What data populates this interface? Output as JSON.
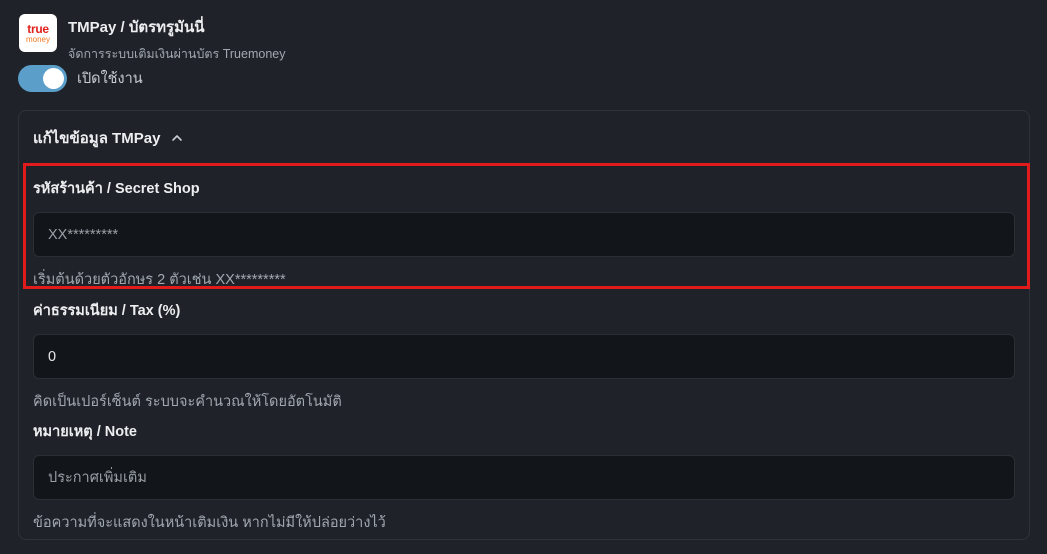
{
  "header": {
    "logo_line1": "true",
    "logo_line2": "money",
    "title": "TMPay / บัตรทรูมันนี่",
    "subtitle": "จัดการระบบเติมเงินผ่านบัตร Truemoney"
  },
  "toggle": {
    "label": "เปิดใช้งาน",
    "state": "on"
  },
  "panel": {
    "title": "แก้ไขข้อมูล TMPay",
    "fields": [
      {
        "label": "รหัสร้านค้า / Secret Shop",
        "value": "XX*********",
        "placeholder": "XX*********",
        "hint": "เริ่มต้นด้วยตัวอักษร 2 ตัวเช่น XX*********"
      },
      {
        "label": "ค่าธรรมเนียม / Tax (%)",
        "value": "0",
        "hint": "คิดเป็นเปอร์เซ็นต์ ระบบจะคำนวณให้โดยอัตโนมัติ"
      },
      {
        "label": "หมายเหตุ / Note",
        "value": "",
        "placeholder": "ประกาศเพิ่มเติม",
        "hint": "ข้อความที่จะแสดงในหน้าเติมเงิน หากไม่มีให้ปล่อยว่างไว้"
      }
    ]
  },
  "colors": {
    "background": "#1f2329",
    "toggle_on": "#5b9ec9",
    "highlight": "#e11b1b"
  },
  "icons": {
    "collapse": "chevron-up-icon"
  }
}
